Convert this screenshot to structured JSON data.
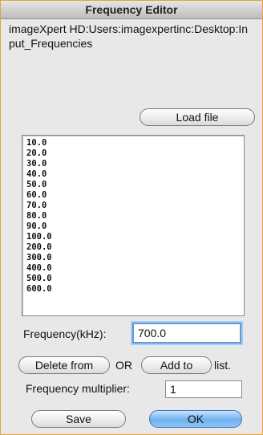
{
  "window": {
    "title": "Frequency Editor"
  },
  "file_path": "imageXpert HD:Users:imagexpertinc:Desktop:Input_Frequencies",
  "load_button": "Load file",
  "frequencies": [
    "10.0",
    "20.0",
    "30.0",
    "40.0",
    "50.0",
    "60.0",
    "70.0",
    "80.0",
    "90.0",
    "100.0",
    "200.0",
    "300.0",
    "400.0",
    "500.0",
    "600.0"
  ],
  "frequency_label": "Frequency(kHz):",
  "frequency_value": "700.0",
  "delete_button": "Delete from",
  "or_label": "OR",
  "add_button": "Add to",
  "list_label": "list.",
  "multiplier_label": "Frequency multiplier:",
  "multiplier_value": "1",
  "save_button": "Save",
  "ok_button": "OK",
  "colors": {
    "window_border": "#e8a23a",
    "default_button": "#6fb1ee",
    "focus_ring": "#5d9ae0"
  }
}
